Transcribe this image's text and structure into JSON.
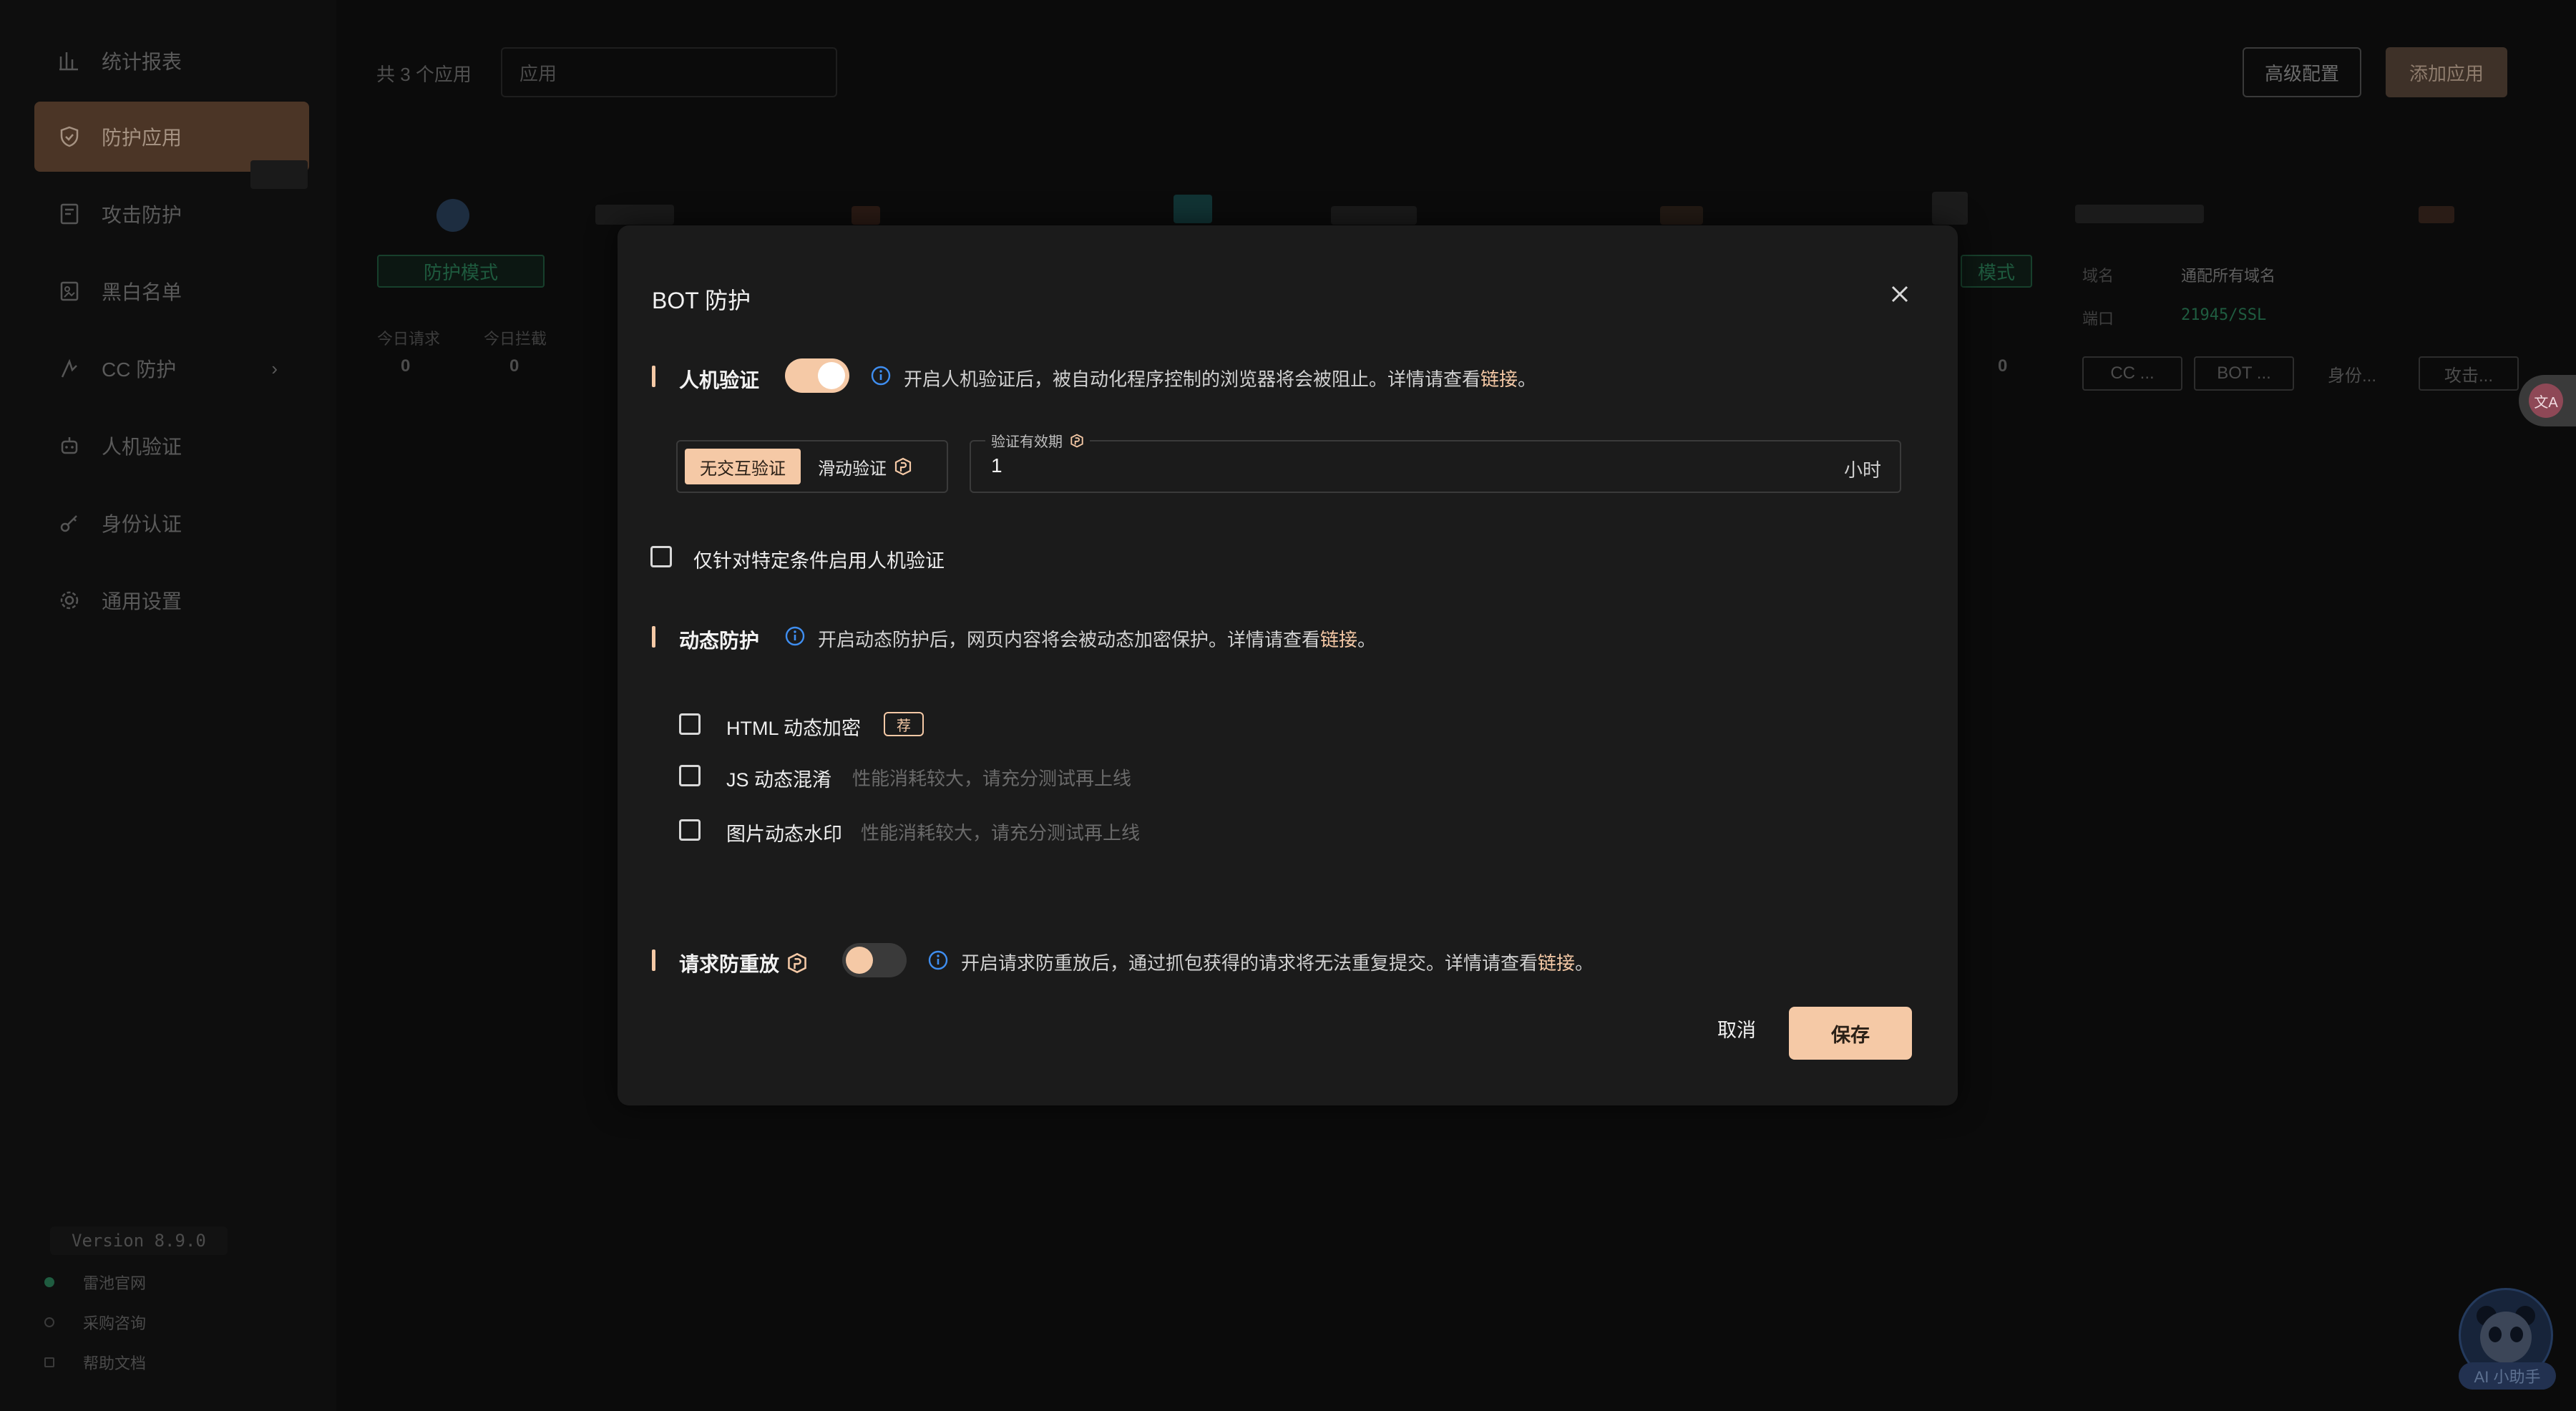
{
  "sidebar": {
    "items": [
      {
        "label": "统计报表",
        "icon": "bar-chart-icon"
      },
      {
        "label": "防护应用",
        "icon": "shield-icon"
      },
      {
        "label": "攻击防护",
        "icon": "document-shield-icon"
      },
      {
        "label": "黑白名单",
        "icon": "list-icon"
      },
      {
        "label": "CC 防护",
        "icon": "cc-icon"
      },
      {
        "label": "人机验证",
        "icon": "robot-icon"
      },
      {
        "label": "身份认证",
        "icon": "key-icon"
      },
      {
        "label": "通用设置",
        "icon": "gear-icon"
      }
    ],
    "version": "Version 8.9.0",
    "footer_links": [
      {
        "label": "雷池官网",
        "color": "#1f5c40"
      },
      {
        "label": "采购咨询",
        "color": "#3a3a3a"
      },
      {
        "label": "帮助文档",
        "color": "#3a3a3a"
      }
    ]
  },
  "topbar": {
    "count_text": "共 3 个应用",
    "search_placeholder": "应用",
    "advanced_label": "高级配置",
    "add_label": "添加应用"
  },
  "app_cards": {
    "mode_tag": "防护模式",
    "mode_tag_partial": "模式",
    "stat_labels": [
      "今日请求",
      "今日拦截"
    ],
    "stat_values": [
      "0",
      "0"
    ],
    "right_stat_value": "0",
    "domain_label": "域名",
    "domain_value": "通配所有域名",
    "port_label": "端口",
    "port_value": "21945/SSL",
    "chip_buttons": [
      "CC ...",
      "BOT ...",
      "身份...",
      "攻击..."
    ]
  },
  "assistant": {
    "label": "AI 小助手",
    "translate_text": "文A"
  },
  "modal": {
    "title": "BOT 防护",
    "human_verify": {
      "title": "人机验证",
      "enabled": true,
      "info_prefix": "开启人机验证后，被自动化程序控制的浏览器将会被阻止。详情请查看",
      "link": "链接",
      "info_suffix": "。",
      "mode_options": [
        "无交互验证",
        "滑动验证"
      ],
      "selected_mode": "无交互验证",
      "validity_label": "验证有效期",
      "validity_value": "1",
      "validity_unit": "小时",
      "conditional_label": "仅针对特定条件启用人机验证",
      "conditional_checked": false
    },
    "dynamic_protect": {
      "title": "动态防护",
      "info_prefix": "开启动态防护后，网页内容将会被动态加密保护。详情请查看",
      "link": "链接",
      "info_suffix": "。",
      "options": [
        {
          "label": "HTML 动态加密",
          "badge": "荐",
          "hint": "",
          "checked": false
        },
        {
          "label": "JS 动态混淆",
          "badge": "",
          "hint": "性能消耗较大，请充分测试再上线",
          "checked": false
        },
        {
          "label": "图片动态水印",
          "badge": "",
          "hint": "性能消耗较大，请充分测试再上线",
          "checked": false
        }
      ]
    },
    "replay_protect": {
      "title": "请求防重放",
      "enabled": false,
      "info_prefix": "开启请求防重放后，通过抓包获得的请求将无法重复提交。详情请查看",
      "link": "链接",
      "info_suffix": "。"
    },
    "cancel_label": "取消",
    "save_label": "保存"
  },
  "colors": {
    "accent": "#f5c9a6",
    "info_blue": "#3f8ef0",
    "modal_bg": "#1b1b1b",
    "page_bg": "#0b0b0b"
  }
}
